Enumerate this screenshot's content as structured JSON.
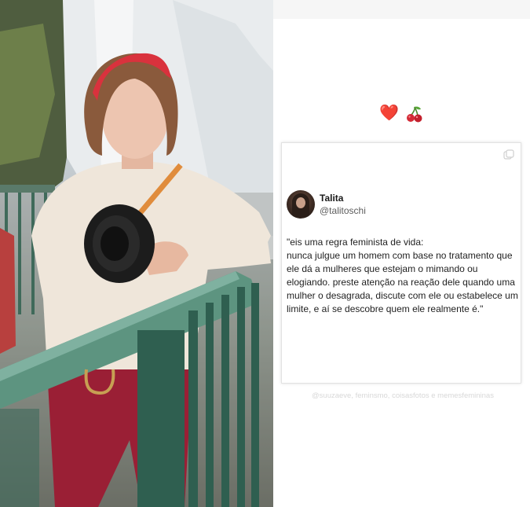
{
  "post": {
    "emojis": {
      "heart": "❤️",
      "cherry_icon": "cherries-icon"
    },
    "tweet": {
      "author_name": "Talita",
      "author_handle": "@talitoschi",
      "text": "\"eis uma regra feminista de vida:\nnunca julgue um homem com base no tratamento que ele dá a mulheres que estejam o mimando ou elogiando. preste atenção na reação dele quando uma mulher o desagrada, discute com ele ou estabelece um limite, e aí se descobre quem ele realmente é.\""
    },
    "credits": "@suuzaeve, feminsmo, coisasfotos e memesfemininas",
    "colors": {
      "heart": "#d62631",
      "card_border": "#e2e2e2",
      "background": "#ffffff"
    }
  }
}
